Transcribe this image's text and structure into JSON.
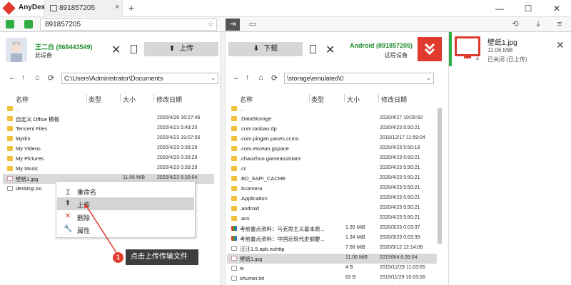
{
  "app": {
    "title": "AnyDesk"
  },
  "tab": {
    "label": "891857205",
    "close": "×"
  },
  "new_tab": "+",
  "window": {
    "minimize": "—",
    "maximize": "☐",
    "close": "✕"
  },
  "toolbar": {
    "address_value": "891857205",
    "star": "☆"
  },
  "local": {
    "name": "王二白 (868443549)",
    "device": "此设备",
    "path": "C:\\Users\\Administrator\\Documents",
    "upload_label": "上传",
    "columns": {
      "name": "名称",
      "type": "类型",
      "size": "大小",
      "date": "修改日期"
    },
    "files": [
      {
        "name": "..",
        "size": "",
        "date": "",
        "kind": "folder"
      },
      {
        "name": "自定义 Office 模板",
        "size": "",
        "date": "2020/4/26 16:27:46",
        "kind": "folder"
      },
      {
        "name": "Tencent Files",
        "size": "",
        "date": "2020/4/23 5:49:20",
        "kind": "folder"
      },
      {
        "name": "Mydm",
        "size": "",
        "date": "2020/4/23 19:07:56",
        "kind": "folder"
      },
      {
        "name": "My Videos",
        "size": "",
        "date": "2020/4/23 0:39:29",
        "kind": "folder"
      },
      {
        "name": "My Pictures",
        "size": "",
        "date": "2020/4/23 0:39:29",
        "kind": "folder"
      },
      {
        "name": "My Music",
        "size": "",
        "date": "2020/4/23 0:39:29",
        "kind": "folder"
      },
      {
        "name": "壁纸1.jpg",
        "size": "11.06 MiB",
        "date": "2020/4/23 6:39:04",
        "kind": "img",
        "selected": true
      },
      {
        "name": "desktop.ini",
        "size": "",
        "date": "...6",
        "kind": "doc"
      }
    ]
  },
  "remote": {
    "name": "Android (891857205)",
    "device": "远程设备",
    "path": "\\storage\\emulated\\0",
    "download_label": "下载",
    "columns": {
      "name": "名称",
      "type": "类型",
      "size": "大小",
      "date": "修改日期"
    },
    "files": [
      {
        "name": "..",
        "size": "",
        "date": "",
        "kind": "folder"
      },
      {
        "name": ".DataStorage",
        "size": "",
        "date": "2020/4/27 10:05:50",
        "kind": "folder"
      },
      {
        "name": ".com.taobao.dp",
        "size": "",
        "date": "2020/4/23 5:50:21",
        "kind": "folder"
      },
      {
        "name": ".com.pingan.paces.ccms",
        "size": "",
        "date": "2019/12/17 11:59:04",
        "kind": "folder"
      },
      {
        "name": ".com.excean.gspace",
        "size": "",
        "date": "2020/4/23 5:50:18",
        "kind": "folder"
      },
      {
        "name": ".chaozhuo.gameassistant",
        "size": "",
        "date": "2020/4/23 5:50:21",
        "kind": "folder"
      },
      {
        "name": ".cc",
        "size": "",
        "date": "2020/4/23 5:50:21",
        "kind": "folder"
      },
      {
        "name": ".BD_SAPI_CACHE",
        "size": "",
        "date": "2020/4/23 5:50:21",
        "kind": "folder"
      },
      {
        "name": ".bcamera",
        "size": "",
        "date": "2020/4/23 5:50:21",
        "kind": "folder"
      },
      {
        "name": ".Application",
        "size": "",
        "date": "2020/4/23 5:50:21",
        "kind": "folder"
      },
      {
        "name": ".android",
        "size": "",
        "date": "2020/4/23 5:50:21",
        "kind": "folder"
      },
      {
        "name": ".acs",
        "size": "",
        "date": "2020/4/23 5:50:21",
        "kind": "folder"
      },
      {
        "name": "考前重点资料：马克思主义基本原...",
        "size": "1.35 MiB",
        "date": "2020/3/23 0:03:37",
        "kind": "multi"
      },
      {
        "name": "考前重点资料：中国近现代史纲要...",
        "size": "1.34 MiB",
        "date": "2020/3/23 0:03:39",
        "kind": "multi"
      },
      {
        "name": "汪汪1.5.apk.nohttp",
        "size": "7.68 MiB",
        "date": "2020/3/12 12:14:08",
        "kind": "doc"
      },
      {
        "name": "壁纸1.jpg",
        "size": "11.06 MiB",
        "date": "2019/8/4 6:39:04",
        "kind": "img",
        "selected": true
      },
      {
        "name": "w",
        "size": "4 B",
        "date": "2019/12/29 11:03:05",
        "kind": "doc"
      },
      {
        "name": "shumei.txt",
        "size": "62 B",
        "date": "2019/11/29 10:03:06",
        "kind": "doc"
      },
      {
        "name": "QTAudioEngine",
        "size": "0 B",
        "date": "2019/12/15 23:37:24",
        "kind": "doc"
      }
    ]
  },
  "context_menu": [
    {
      "label": "重命名",
      "icon": "rename-icon",
      "glyph": "Ɪ"
    },
    {
      "label": "上传",
      "icon": "upload-icon",
      "glyph": "⬆",
      "active": true
    },
    {
      "label": "删除",
      "icon": "delete-icon",
      "glyph": "✕",
      "color": "#d8322a"
    },
    {
      "label": "属性",
      "icon": "wrench-icon",
      "glyph": "🔧"
    }
  ],
  "annotation": {
    "number": "1",
    "text": "点击上传传输文件"
  },
  "notification": {
    "title": "壁纸1.jpg",
    "size": "11.06 MiB",
    "status": "已关闭 (已上传)"
  },
  "colors": {
    "accent": "#e0392d",
    "online": "#1f8f2f",
    "notify_bar": "#2fae45",
    "selection": "#d9d9d9"
  }
}
